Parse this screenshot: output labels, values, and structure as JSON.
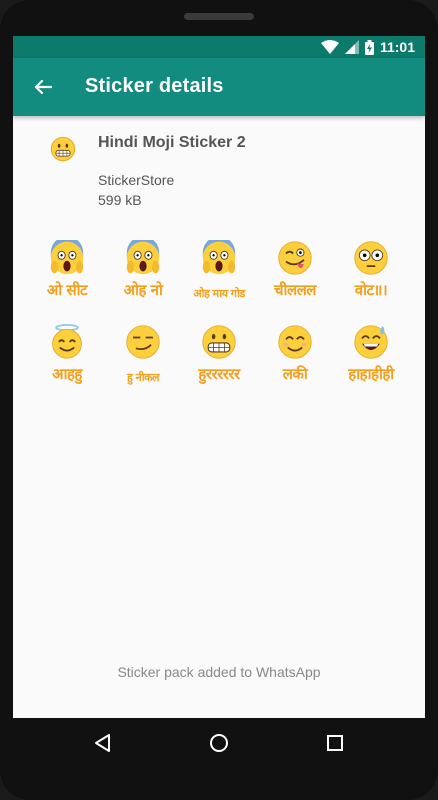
{
  "status_bar": {
    "time": "11:01",
    "icons": [
      "wifi-icon",
      "signal-icon",
      "battery-charging-icon"
    ]
  },
  "app_bar": {
    "title": "Sticker details",
    "back_icon": "arrow-back-icon"
  },
  "pack": {
    "name": "Hindi Moji Sticker 2",
    "publisher": "StickerStore",
    "size": "599 kB",
    "icon": "grimacing-face-icon"
  },
  "stickers": [
    {
      "caption": "ओ सीट",
      "face": "screaming-face"
    },
    {
      "caption": "ओह नो",
      "face": "screaming-face"
    },
    {
      "caption": "ओह माय गोड",
      "face": "screaming-face"
    },
    {
      "caption": "चीललल",
      "face": "winking-tongue-face"
    },
    {
      "caption": "वोट॥।",
      "face": "flushed-face"
    },
    {
      "caption": "आहहु",
      "face": "halo-face"
    },
    {
      "caption": "हु नीकल",
      "face": "smirk-face"
    },
    {
      "caption": "हुरररररर",
      "face": "grimacing-face"
    },
    {
      "caption": "लकी",
      "face": "smiling-face"
    },
    {
      "caption": "हाहाहीही",
      "face": "sweat-smile-face"
    }
  ],
  "footer": {
    "note": "Sticker pack added to WhatsApp"
  },
  "nav_bar": {
    "icons": [
      "back-triangle-icon",
      "home-circle-icon",
      "recents-square-icon"
    ]
  },
  "colors": {
    "status_bar": "#0d7b6b",
    "app_bar": "#118c7e",
    "caption": "#f2a01e",
    "emoji_yellow": "#fcd03c"
  }
}
